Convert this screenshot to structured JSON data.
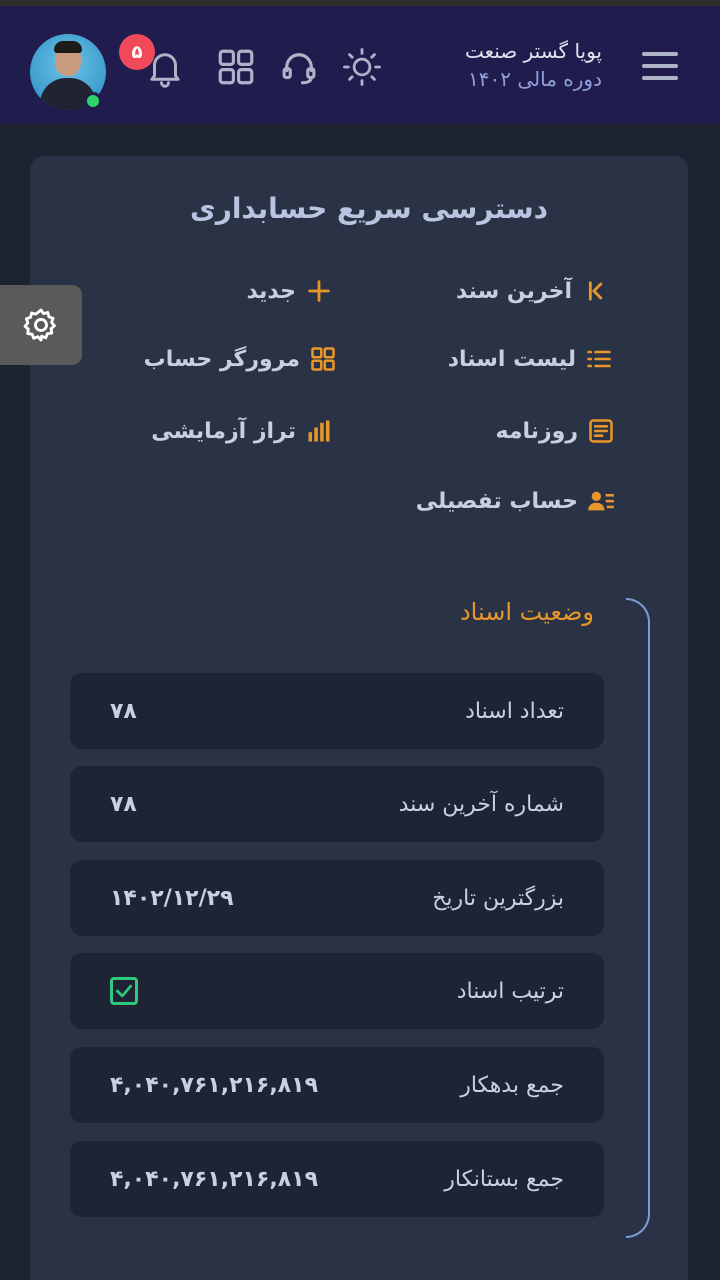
{
  "header": {
    "company_name": "پویا گستر صنعت",
    "fiscal_period": "دوره مالی ۱۴۰۲",
    "notification_count": "۵",
    "icons": [
      "menu-icon",
      "sun-icon",
      "headset-icon",
      "apps-grid-icon",
      "bell-icon",
      "user-avatar"
    ]
  },
  "quick_access": {
    "title": "دسترسی سریع حسابداری",
    "items": [
      {
        "label": "آخرین سند",
        "icon": "last-icon"
      },
      {
        "label": "جدید",
        "icon": "plus-icon"
      },
      {
        "label": "لیست اسناد",
        "icon": "list-icon"
      },
      {
        "label": "مرورگر حساب",
        "icon": "grid-icon"
      },
      {
        "label": "روزنامه",
        "icon": "journal-icon"
      },
      {
        "label": "تراز آزمایشی",
        "icon": "bar-chart-icon"
      },
      {
        "label": "حساب تفصیلی",
        "icon": "user-list-icon"
      }
    ]
  },
  "status": {
    "title": "وضعیت اسناد",
    "rows": [
      {
        "key": "تعداد اسناد",
        "value": "۷۸"
      },
      {
        "key": "شماره آخرین سند",
        "value": "۷۸"
      },
      {
        "key": "بزرگترین تاریخ",
        "value": "۱۴۰۲/۱۲/۲۹"
      },
      {
        "key": "ترتیب اسناد",
        "value": ""
      },
      {
        "key": "جمع بدهکار",
        "value": "۴,۰۴۰,۷۶۱,۲۱۶,۸۱۹"
      },
      {
        "key": "جمع بستانکار",
        "value": "۴,۰۴۰,۷۶۱,۲۱۶,۸۱۹"
      }
    ]
  },
  "colors": {
    "header_bg": "#211c4e",
    "accent_orange": "#e8962a",
    "check_green": "#2ec97c",
    "badge_red": "#f04a5a"
  }
}
